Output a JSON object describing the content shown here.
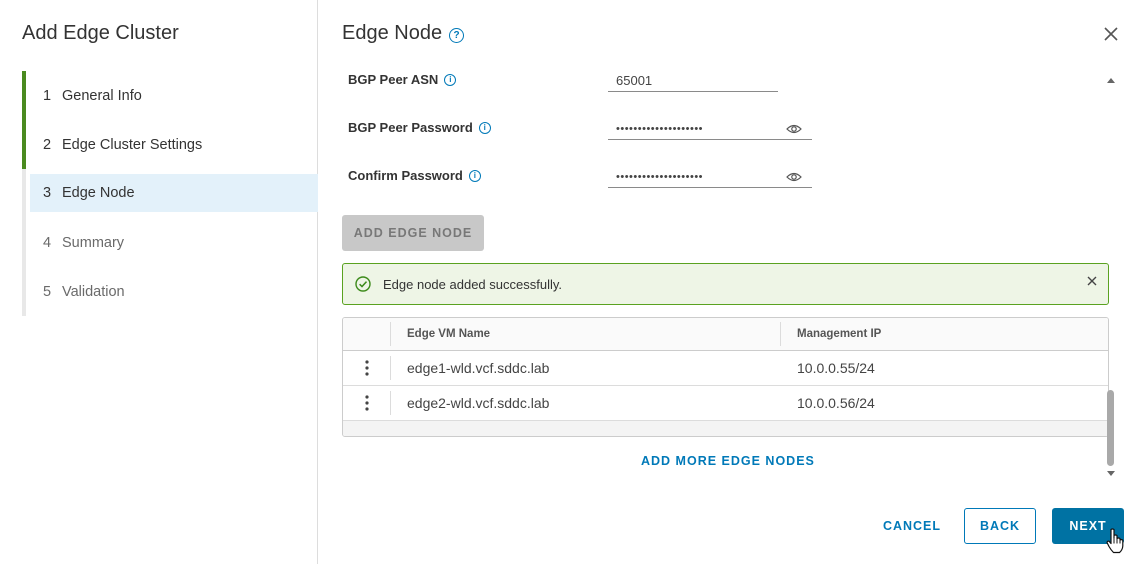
{
  "wizard": {
    "title": "Add Edge Cluster",
    "steps": [
      {
        "num": "1",
        "label": "General Info",
        "state": "done"
      },
      {
        "num": "2",
        "label": "Edge Cluster Settings",
        "state": "done"
      },
      {
        "num": "3",
        "label": "Edge Node",
        "state": "current"
      },
      {
        "num": "4",
        "label": "Summary",
        "state": "pending"
      },
      {
        "num": "5",
        "label": "Validation",
        "state": "pending"
      }
    ]
  },
  "page": {
    "title": "Edge Node",
    "help_icon": "question-circle-icon",
    "close_icon": "close-icon"
  },
  "form": {
    "bgp_peer_asn": {
      "label": "BGP Peer ASN",
      "value": "65001"
    },
    "bgp_peer_password": {
      "label": "BGP Peer Password",
      "value": "••••••••••••••••••••"
    },
    "confirm_password": {
      "label": "Confirm Password",
      "value": "••••••••••••••••••••"
    }
  },
  "actions": {
    "add_edge_node": "ADD EDGE NODE",
    "add_more_edge_nodes": "ADD MORE EDGE NODES"
  },
  "alert": {
    "message": "Edge node added successfully.",
    "type": "success"
  },
  "table": {
    "columns": [
      "Edge VM Name",
      "Management IP"
    ],
    "rows": [
      {
        "name": "edge1-wld.vcf.sddc.lab",
        "ip": "10.0.0.55/24"
      },
      {
        "name": "edge2-wld.vcf.sddc.lab",
        "ip": "10.0.0.56/24"
      }
    ]
  },
  "footer": {
    "cancel": "CANCEL",
    "back": "BACK",
    "next": "NEXT"
  },
  "colors": {
    "accent": "#0079b8",
    "primary_button": "#0072a3",
    "success": "#5aa220",
    "done_step": "#4a8a1f",
    "current_step_bg": "#e3f1fa"
  }
}
